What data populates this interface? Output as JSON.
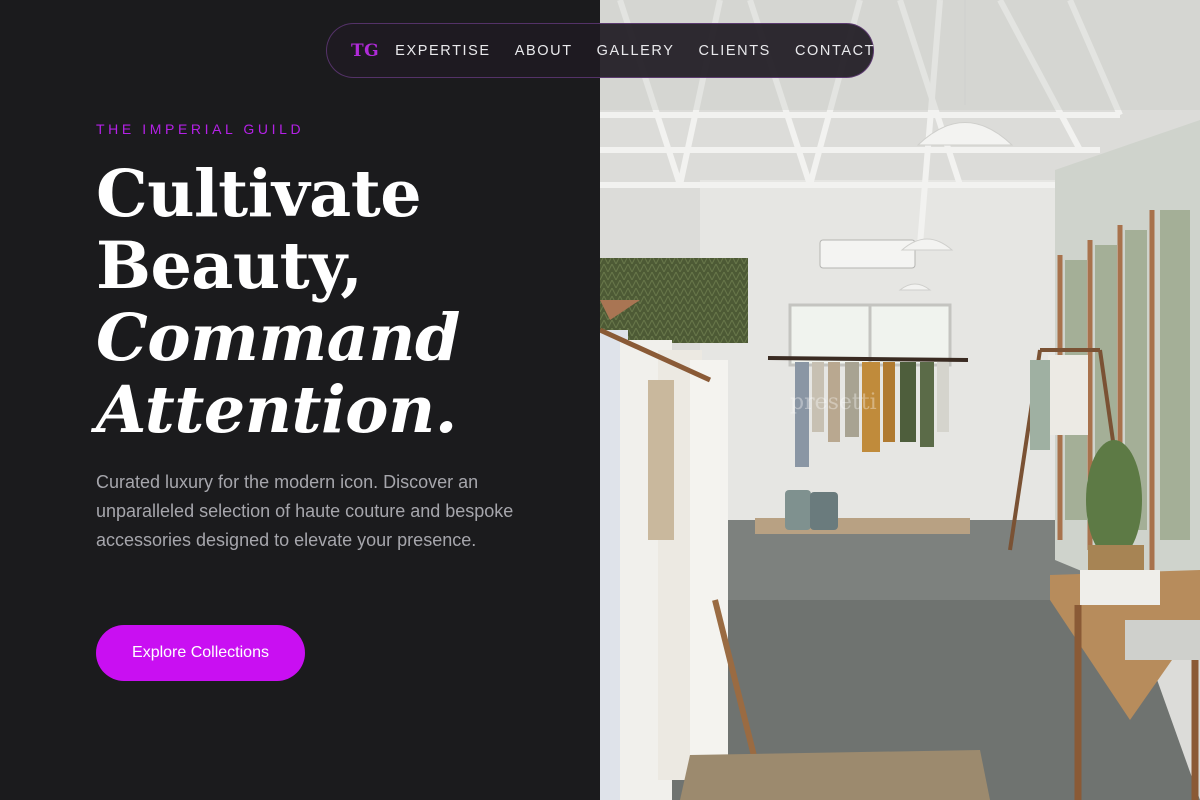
{
  "nav": {
    "logo": "TG",
    "links": [
      "EXPERTISE",
      "ABOUT",
      "GALLERY",
      "CLIENTS",
      "CONTACT"
    ]
  },
  "hero": {
    "eyebrow": "THE IMPERIAL GUILD",
    "headline": [
      "Cultivate",
      "Beauty,",
      "Command",
      "Attention."
    ],
    "body": "Curated luxury for the modern icon. Discover an unparalleled selection of haute couture and bespoke accessories designed to elevate your presence.",
    "cta_label": "Explore Collections"
  },
  "image": {
    "subject": "boutique-store-interior",
    "watermark": "presetti"
  },
  "colors": {
    "accent": "#c90ff2",
    "eyebrow": "#b421e6",
    "background": "#1b1b1d"
  }
}
